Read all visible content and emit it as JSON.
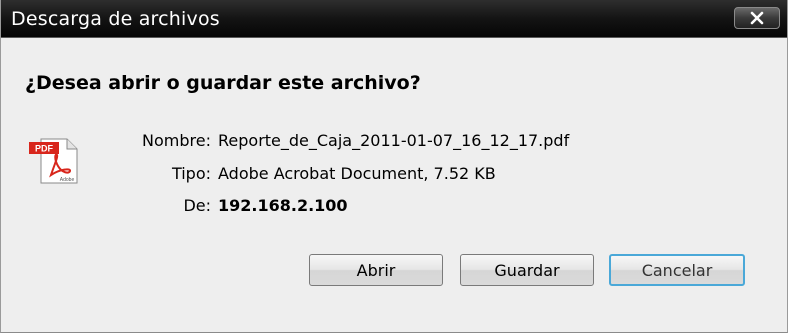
{
  "window": {
    "title": "Descarga de archivos",
    "close_icon": "close-icon"
  },
  "prompt": {
    "question": "¿Desea abrir o guardar este archivo?"
  },
  "file": {
    "icon": "pdf-file-icon",
    "name_label": "Nombre:",
    "name_value": "Reporte_de_Caja_2011-01-07_16_12_17.pdf",
    "type_label": "Tipo:",
    "type_value": "Adobe Acrobat Document, 7.52 KB",
    "from_label": "De:",
    "from_value": "192.168.2.100"
  },
  "buttons": {
    "open": "Abrir",
    "save": "Guardar",
    "cancel": "Cancelar"
  },
  "colors": {
    "titlebar": "#141414",
    "cancel_focus_border": "#4aa8d8",
    "pdf_red": "#d8261c"
  }
}
